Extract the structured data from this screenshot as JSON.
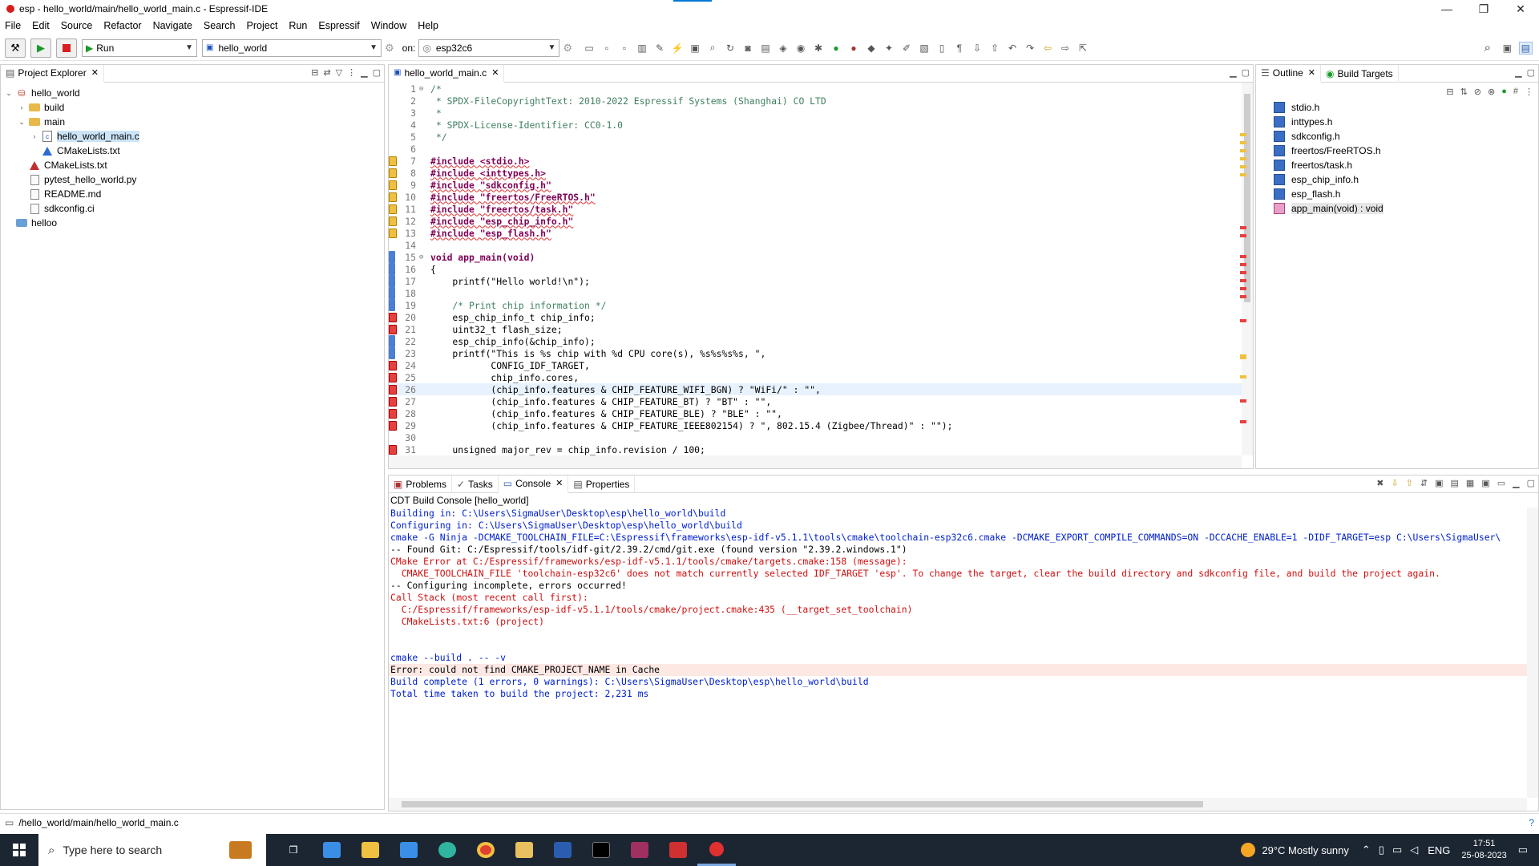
{
  "window": {
    "title": "esp - hello_world/main/hello_world_main.c - Espressif-IDE",
    "buttons": [
      "—",
      "❐",
      "✕"
    ]
  },
  "menu": [
    "File",
    "Edit",
    "Source",
    "Refactor",
    "Navigate",
    "Search",
    "Project",
    "Run",
    "Espressif",
    "Window",
    "Help"
  ],
  "toolbar": {
    "launch_mode": "Run",
    "launch_config": "hello_world",
    "on_label": "on:",
    "target": "esp32c6"
  },
  "project_explorer": {
    "tab": "Project Explorer",
    "items": [
      {
        "label": "hello_world",
        "icon": "project-icon"
      },
      {
        "label": "build",
        "icon": "folder-icon"
      },
      {
        "label": "main",
        "icon": "folder-icon"
      },
      {
        "label": "hello_world_main.c",
        "icon": "c-file-icon"
      },
      {
        "label": "CMakeLists.txt",
        "icon": "cmake-icon"
      },
      {
        "label": "CMakeLists.txt",
        "icon": "cmake-icon"
      },
      {
        "label": "pytest_hello_world.py",
        "icon": "file-icon"
      },
      {
        "label": "README.md",
        "icon": "file-icon"
      },
      {
        "label": "sdkconfig.ci",
        "icon": "file-icon"
      },
      {
        "label": "helloo",
        "icon": "project-icon"
      }
    ]
  },
  "editor": {
    "tab": "hello_world_main.c",
    "lines": [
      {
        "n": "1",
        "t": "/*"
      },
      {
        "n": "2",
        "t": " * SPDX-FileCopyrightText: 2010-2022 Espressif Systems (Shanghai) CO LTD"
      },
      {
        "n": "3",
        "t": " *"
      },
      {
        "n": "4",
        "t": " * SPDX-License-Identifier: CC0-1.0"
      },
      {
        "n": "5",
        "t": " */"
      },
      {
        "n": "6",
        "t": ""
      },
      {
        "n": "7",
        "t": "#include <stdio.h>"
      },
      {
        "n": "8",
        "t": "#include <inttypes.h>"
      },
      {
        "n": "9",
        "t": "#include \"sdkconfig.h\""
      },
      {
        "n": "10",
        "t": "#include \"freertos/FreeRTOS.h\""
      },
      {
        "n": "11",
        "t": "#include \"freertos/task.h\""
      },
      {
        "n": "12",
        "t": "#include \"esp_chip_info.h\""
      },
      {
        "n": "13",
        "t": "#include \"esp_flash.h\""
      },
      {
        "n": "14",
        "t": ""
      },
      {
        "n": "15",
        "t": "void app_main(void)"
      },
      {
        "n": "16",
        "t": "{"
      },
      {
        "n": "17",
        "t": "    printf(\"Hello world!\\n\");"
      },
      {
        "n": "18",
        "t": ""
      },
      {
        "n": "19",
        "t": "    /* Print chip information */"
      },
      {
        "n": "20",
        "t": "    esp_chip_info_t chip_info;"
      },
      {
        "n": "21",
        "t": "    uint32_t flash_size;"
      },
      {
        "n": "22",
        "t": "    esp_chip_info(&chip_info);"
      },
      {
        "n": "23",
        "t": "    printf(\"This is %s chip with %d CPU core(s), %s%s%s%s, \","
      },
      {
        "n": "24",
        "t": "           CONFIG_IDF_TARGET,"
      },
      {
        "n": "25",
        "t": "           chip_info.cores,"
      },
      {
        "n": "26",
        "t": "           (chip_info.features & CHIP_FEATURE_WIFI_BGN) ? \"WiFi/\" : \"\","
      },
      {
        "n": "27",
        "t": "           (chip_info.features & CHIP_FEATURE_BT) ? \"BT\" : \"\","
      },
      {
        "n": "28",
        "t": "           (chip_info.features & CHIP_FEATURE_BLE) ? \"BLE\" : \"\","
      },
      {
        "n": "29",
        "t": "           (chip_info.features & CHIP_FEATURE_IEEE802154) ? \", 802.15.4 (Zigbee/Thread)\" : \"\");"
      },
      {
        "n": "30",
        "t": ""
      },
      {
        "n": "31",
        "t": "    unsigned major_rev = chip_info.revision / 100;"
      }
    ]
  },
  "outline": {
    "tabs": [
      "Outline",
      "Build Targets"
    ],
    "items": [
      "stdio.h",
      "inttypes.h",
      "sdkconfig.h",
      "freertos/FreeRTOS.h",
      "freertos/task.h",
      "esp_chip_info.h",
      "esp_flash.h",
      "app_main(void) : void"
    ]
  },
  "bottom": {
    "tabs": [
      "Problems",
      "Tasks",
      "Console",
      "Properties"
    ],
    "console_title": "CDT Build Console [hello_world]",
    "lines": [
      {
        "c": "blue",
        "t": "Building in: C:\\Users\\SigmaUser\\Desktop\\esp\\hello_world\\build"
      },
      {
        "c": "blue",
        "t": "Configuring in: C:\\Users\\SigmaUser\\Desktop\\esp\\hello_world\\build"
      },
      {
        "c": "blue",
        "t": "cmake -G Ninja -DCMAKE_TOOLCHAIN_FILE=C:\\Espressif\\frameworks\\esp-idf-v5.1.1\\tools\\cmake\\toolchain-esp32c6.cmake -DCMAKE_EXPORT_COMPILE_COMMANDS=ON -DCCACHE_ENABLE=1 -DIDF_TARGET=esp C:\\Users\\SigmaUser\\"
      },
      {
        "c": "black",
        "t": "-- Found Git: C:/Espressif/tools/idf-git/2.39.2/cmd/git.exe (found version \"2.39.2.windows.1\")"
      },
      {
        "c": "red",
        "t": "CMake Error at C:/Espressif/frameworks/esp-idf-v5.1.1/tools/cmake/targets.cmake:158 (message):"
      },
      {
        "c": "red",
        "t": "  CMAKE_TOOLCHAIN_FILE 'toolchain-esp32c6' does not match currently selected IDF_TARGET 'esp'. To change the target, clear the build directory and sdkconfig file, and build the project again."
      },
      {
        "c": "black",
        "t": "-- Configuring incomplete, errors occurred!"
      },
      {
        "c": "red",
        "t": "Call Stack (most recent call first):"
      },
      {
        "c": "red",
        "t": "  C:/Espressif/frameworks/esp-idf-v5.1.1/tools/cmake/project.cmake:435 (__target_set_toolchain)"
      },
      {
        "c": "red",
        "t": "  CMakeLists.txt:6 (project)"
      },
      {
        "c": "black",
        "t": ""
      },
      {
        "c": "black",
        "t": ""
      },
      {
        "c": "blue",
        "t": "cmake --build . -- -v"
      },
      {
        "c": "errbg",
        "t": "Error: could not find CMAKE_PROJECT_NAME in Cache"
      },
      {
        "c": "blue",
        "t": "Build complete (1 errors, 0 warnings): C:\\Users\\SigmaUser\\Desktop\\esp\\hello_world\\build"
      },
      {
        "c": "blue",
        "t": "Total time taken to build the project: 2,231 ms"
      }
    ]
  },
  "status": {
    "path": "/hello_world/main/hello_world_main.c"
  },
  "taskbar": {
    "search_placeholder": "Type here to search",
    "weather": "29°C  Mostly sunny",
    "lang": "ENG",
    "time": "17:51",
    "date": "25-08-2023"
  },
  "colors": {
    "keyword": "#7f0055",
    "string": "#2a00ff",
    "comment": "#3f7f5f",
    "error": "#d01010",
    "link": "#0020d0"
  }
}
